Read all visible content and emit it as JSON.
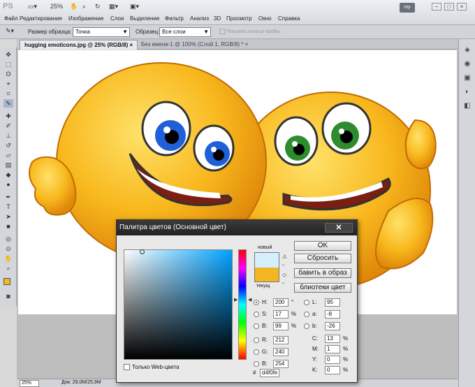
{
  "app": {
    "logo": "PS",
    "zoom_top": "25%",
    "workspace": "my"
  },
  "menu": [
    "Файл",
    "Редактирование",
    "Изображение",
    "Слои",
    "Выделение",
    "Фильтр",
    "Анализ",
    "3D",
    "Просмотр",
    "Окно",
    "Справка"
  ],
  "options": {
    "sample_size_label": "Размер образца:",
    "sample_size_value": "Точка",
    "sample_label": "Образец:",
    "sample_value": "Все слои",
    "ring_label": "Показать кольцо пробы"
  },
  "tabs": [
    {
      "label": "hugging emoticons.jpg @ 25% (RGB/8)",
      "close": "×"
    },
    {
      "label": "Без имени-1 @ 100% (Слой 1, RGB/8) *",
      "close": "×"
    }
  ],
  "status": {
    "zoom": "25%",
    "doc": "Док: 29,0M/25,9M"
  },
  "dialog": {
    "title": "Палитра цветов (Основной цвет)",
    "close": "✕",
    "new_label": "новый",
    "current_label": "текущ",
    "new_color": "#d4f0fe",
    "current_color": "#f2b623",
    "buttons": {
      "ok": "OK",
      "reset": "Сбросить",
      "add_swatch": "бавить в образ",
      "libraries": "блиотеки цвет"
    },
    "hsb": [
      {
        "label": "H:",
        "value": "200",
        "unit": "°"
      },
      {
        "label": "S:",
        "value": "17",
        "unit": "%"
      },
      {
        "label": "B:",
        "value": "99",
        "unit": "%"
      }
    ],
    "rgb": [
      {
        "label": "R:",
        "value": "212"
      },
      {
        "label": "G:",
        "value": "240"
      },
      {
        "label": "B:",
        "value": "254"
      }
    ],
    "lab": [
      {
        "label": "L:",
        "value": "95"
      },
      {
        "label": "a:",
        "value": "-8"
      },
      {
        "label": "b:",
        "value": "-26"
      }
    ],
    "cmyk": [
      {
        "label": "C:",
        "value": "13",
        "unit": "%"
      },
      {
        "label": "M:",
        "value": "1",
        "unit": "%"
      },
      {
        "label": "Y:",
        "value": "0",
        "unit": "%"
      },
      {
        "label": "K:",
        "value": "0",
        "unit": "%"
      }
    ],
    "web_only": "Только Web-цвета",
    "hex_label": "#",
    "hex_value": "d4f0fe"
  }
}
